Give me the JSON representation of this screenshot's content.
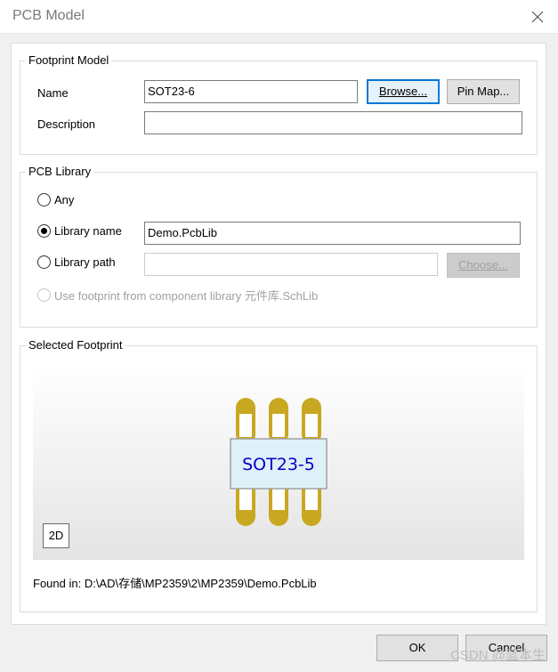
{
  "window": {
    "title": "PCB Model"
  },
  "footprint_model": {
    "title": "Footprint Model",
    "name_label": "Name",
    "name_value": "SOT23-6",
    "description_label": "Description",
    "description_value": "",
    "browse_label": "Browse...",
    "pin_map_label": "Pin Map..."
  },
  "pcb_library": {
    "title": "PCB Library",
    "options": [
      {
        "label": "Any",
        "checked": false,
        "enabled": true
      },
      {
        "label": "Library name",
        "checked": true,
        "enabled": true
      },
      {
        "label": "Library path",
        "checked": false,
        "enabled": true
      },
      {
        "label": "Use footprint from component library 元件库.SchLib",
        "checked": false,
        "enabled": false
      }
    ],
    "library_name_value": "Demo.PcbLib",
    "library_path_value": "",
    "choose_label": "Choose..."
  },
  "selected_footprint": {
    "title": "Selected Footprint",
    "component_label": "SOT23-5",
    "view_mode": "2D",
    "found_in": "Found in: D:\\AD\\存储\\MP2359\\2\\MP2359\\Demo.PcbLib",
    "pad_color": "#c8a820",
    "body_fill": "#dff0f8",
    "label_color": "#0000cc"
  },
  "footer": {
    "ok_label": "OK",
    "cancel_label": "Cancel"
  },
  "watermark": "CSDN @蓝本生"
}
